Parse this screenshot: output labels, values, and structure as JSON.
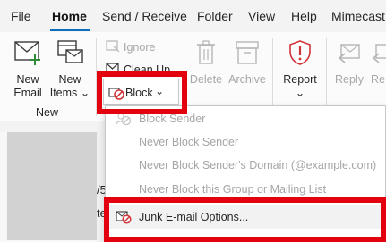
{
  "tabs": [
    {
      "label": "File"
    },
    {
      "label": "Home"
    },
    {
      "label": "Send / Receive"
    },
    {
      "label": "Folder"
    },
    {
      "label": "View"
    },
    {
      "label": "Help"
    },
    {
      "label": "Mimecast"
    }
  ],
  "ribbon": {
    "new_email": [
      "New",
      "Email"
    ],
    "new_items": [
      "New",
      "Items"
    ],
    "new_items_arrow": "⌄",
    "group_new": "New",
    "ignore": "Ignore",
    "cleanup": "Clean Up",
    "cleanup_arrow": "⌄",
    "block": "Block",
    "block_arrow": "⌄",
    "delete": "Delete",
    "archive": "Archive",
    "report": "Report",
    "report_arrow": "⌄",
    "reply": "Reply",
    "re": "Re"
  },
  "fragments": {
    "slash": "/5",
    "cut": "te"
  },
  "menu": {
    "items": [
      {
        "label": "Block Sender"
      },
      {
        "label": "Never Block Sender"
      },
      {
        "label": "Never Block Sender's Domain (@example.com)"
      },
      {
        "label": "Never Block this Group or Mailing List"
      },
      {
        "label": "Junk E-mail Options..."
      }
    ]
  },
  "colors": {
    "accent": "#0f6cbd",
    "highlight": "#e3000f",
    "disabled": "#a6a6a6"
  }
}
